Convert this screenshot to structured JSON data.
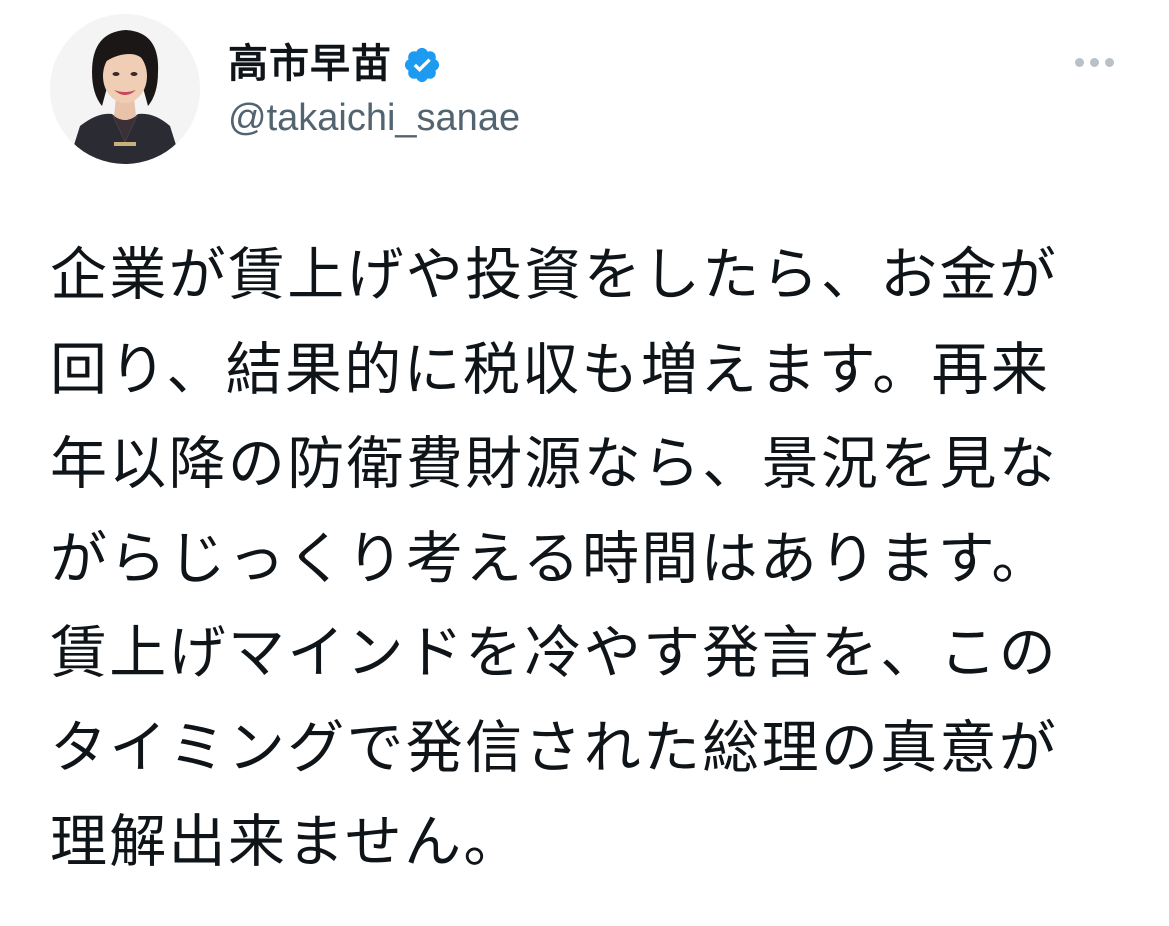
{
  "author": {
    "display_name": "高市早苗",
    "handle": "@takaichi_sanae",
    "verified": true,
    "avatar_icon": "profile-photo",
    "verified_icon": "verified-badge-icon"
  },
  "more_icon": "more-options-icon",
  "colors": {
    "text": "#0f1419",
    "secondary_text": "#536471",
    "verified_blue": "#1d9bf0",
    "more_dots": "#b9c1c8"
  },
  "tweet": {
    "lines": [
      "企業が賃上げや投資をしたら、お金が",
      "回り、結果的に税収も増えます。再来",
      "年以降の防衛費財源なら、景況を見な",
      "がらじっくり考える時間はあります。",
      "賃上げマインドを冷やす発言を、この",
      "タイミングで発信された総理の真意が",
      "理解出来ません。"
    ]
  }
}
